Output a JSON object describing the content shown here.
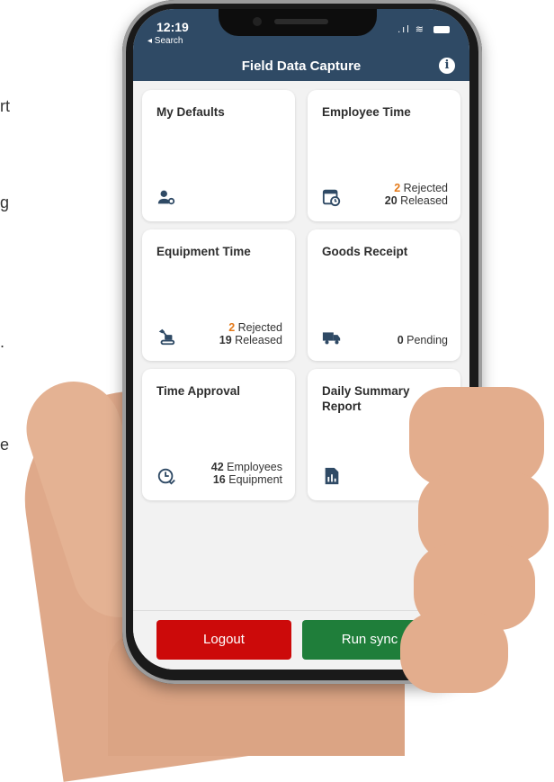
{
  "edge_text": [
    "rt",
    "g",
    ".",
    "e"
  ],
  "status_bar": {
    "time": "12:19",
    "back_label": "◂ Search",
    "signal": ".ıl",
    "wifi": "≋"
  },
  "header": {
    "title": "Field Data Capture",
    "info_icon": "info-icon"
  },
  "tiles": [
    {
      "title": "My Defaults",
      "icon": "user-settings-icon",
      "stats": []
    },
    {
      "title": "Employee Time",
      "icon": "calendar-clock-icon",
      "stats": [
        {
          "count": "2",
          "label": "Rejected",
          "color": "#e47a1a"
        },
        {
          "count": "20",
          "label": "Released",
          "color": "#333333"
        }
      ]
    },
    {
      "title": "Equipment Time",
      "icon": "excavator-icon",
      "stats": [
        {
          "count": "2",
          "label": "Rejected",
          "color": "#e47a1a"
        },
        {
          "count": "19",
          "label": "Released",
          "color": "#333333"
        }
      ]
    },
    {
      "title": "Goods Receipt",
      "icon": "truck-icon",
      "stats": [
        {
          "count": "0",
          "label": "Pending",
          "color": "#333333"
        }
      ]
    },
    {
      "title": "Time Approval",
      "icon": "clock-check-icon",
      "stats": [
        {
          "count": "42",
          "label": "Employees",
          "color": "#333333"
        },
        {
          "count": "16",
          "label": "Equipment",
          "color": "#333333"
        }
      ]
    },
    {
      "title": "Daily Summary Report",
      "icon": "report-chart-icon",
      "stats": []
    }
  ],
  "buttons": {
    "logout": "Logout",
    "sync": "Run sync"
  },
  "colors": {
    "header": "#2f4a65",
    "logout": "#cc0a0a",
    "sync": "#1f7e3a",
    "accent": "#e47a1a"
  }
}
